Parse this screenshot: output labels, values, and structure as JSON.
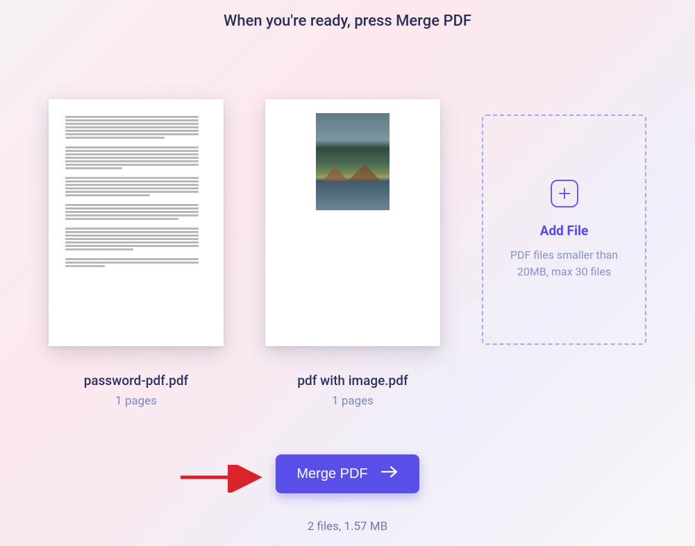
{
  "header": {
    "title": "When you're ready, press Merge PDF"
  },
  "files": [
    {
      "name": "password-pdf.pdf",
      "pages": "1 pages"
    },
    {
      "name": "pdf with image.pdf",
      "pages": "1 pages"
    }
  ],
  "add_file": {
    "title": "Add File",
    "description": "PDF files smaller than 20MB, max 30 files"
  },
  "action": {
    "merge_label": "Merge PDF"
  },
  "summary": {
    "text": "2 files, 1.57 MB"
  }
}
